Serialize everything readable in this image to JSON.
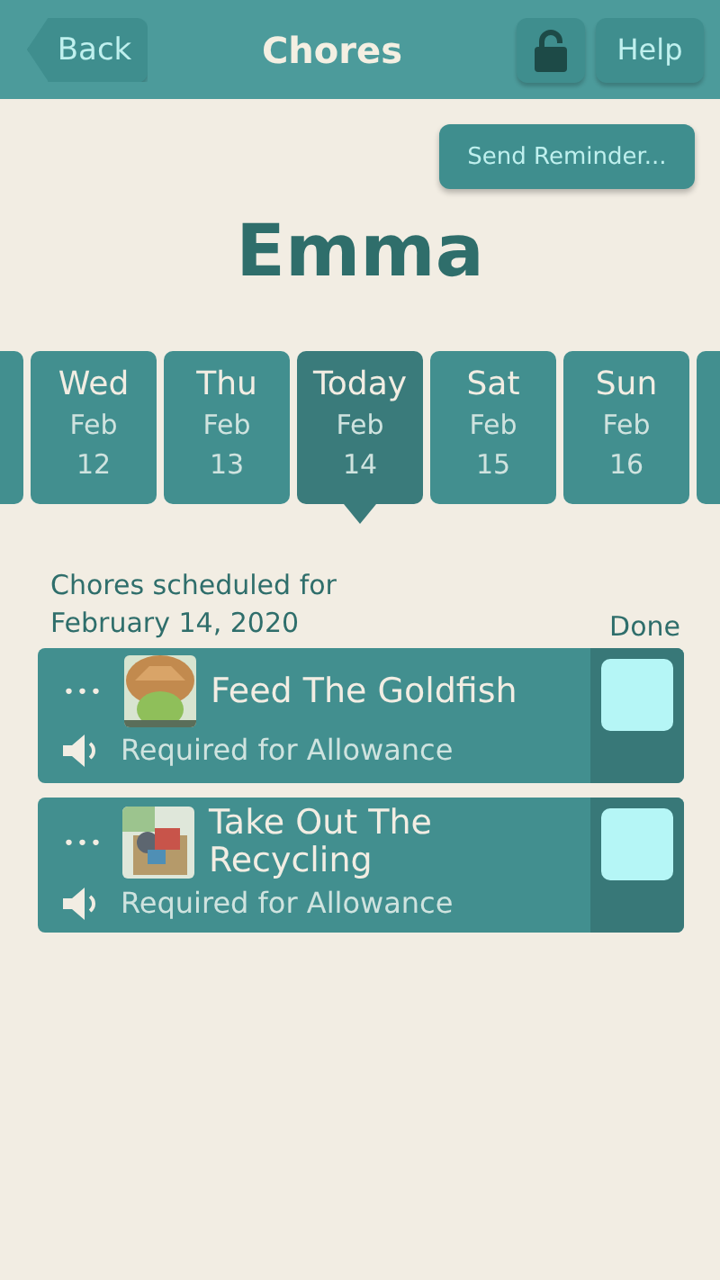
{
  "header": {
    "back": "Back",
    "title": "Chores",
    "locked": false,
    "help": "Help"
  },
  "send_reminder": "Send Reminder...",
  "child_name": "Emma",
  "days": [
    {
      "day": "Wed",
      "month": "Feb",
      "date": "12",
      "selected": false
    },
    {
      "day": "Thu",
      "month": "Feb",
      "date": "13",
      "selected": false
    },
    {
      "day": "Today",
      "month": "Feb",
      "date": "14",
      "selected": true
    },
    {
      "day": "Sat",
      "month": "Feb",
      "date": "15",
      "selected": false
    },
    {
      "day": "Sun",
      "month": "Feb",
      "date": "16",
      "selected": false
    }
  ],
  "schedule_heading": "Chores scheduled for",
  "schedule_date": "February 14, 2020",
  "done_label": "Done",
  "chores": [
    {
      "more": "•••",
      "title": "Feed The Goldfish",
      "note": "Required for Allowance",
      "done": false,
      "kind": "picture"
    },
    {
      "more": "•••",
      "title": "Take Out The Recycling",
      "note": "Required for Allowance",
      "done": false,
      "kind": "picture"
    }
  ]
}
